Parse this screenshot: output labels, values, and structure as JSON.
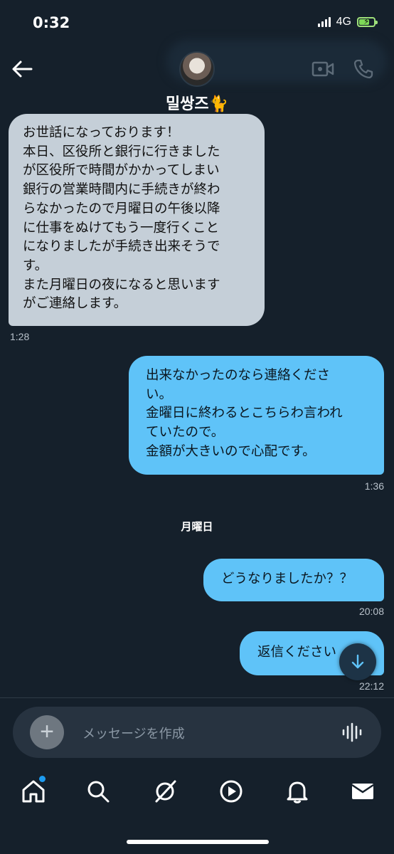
{
  "status_bar": {
    "time": "0:32",
    "network": "4G"
  },
  "header": {
    "contact_name": "밀쌍즈🐈"
  },
  "messages": [
    {
      "sender": "them",
      "text": "お世話になっております！\n本日、区役所と銀行に行きました\nが区役所で時間がかかってしまい\n銀行の営業時間内に手続きが終わ\nらなかったので月曜日の午後以降\nに仕事をぬけてもう一度行くこと\nになりましたが手続き出来そうで\nす。\nまた月曜日の夜になると思います\nがご連絡します。",
      "time": "1:28"
    },
    {
      "sender": "me",
      "text": "出来なかったのなら連絡くださ\nい。\n金曜日に終わるとこちらわ言われ\nていたので。\n金額が大きいので心配です。",
      "time": "1:36"
    },
    {
      "sender": "me",
      "text": "どうなりましたか？？",
      "time": "20:08"
    },
    {
      "sender": "me",
      "text": "返信ください",
      "time": "22:12"
    }
  ],
  "day_separator": "月曜日",
  "composer": {
    "placeholder": "メッセージを作成"
  },
  "tabbar": [
    "home-icon",
    "search-icon",
    "spaces-icon",
    "video-icon",
    "bell-icon",
    "mail-icon"
  ],
  "colors": {
    "background": "#15202b",
    "received_bubble": "#c5cfd8",
    "sent_bubble": "#5fc3f8",
    "accent": "#1d9bf0"
  }
}
